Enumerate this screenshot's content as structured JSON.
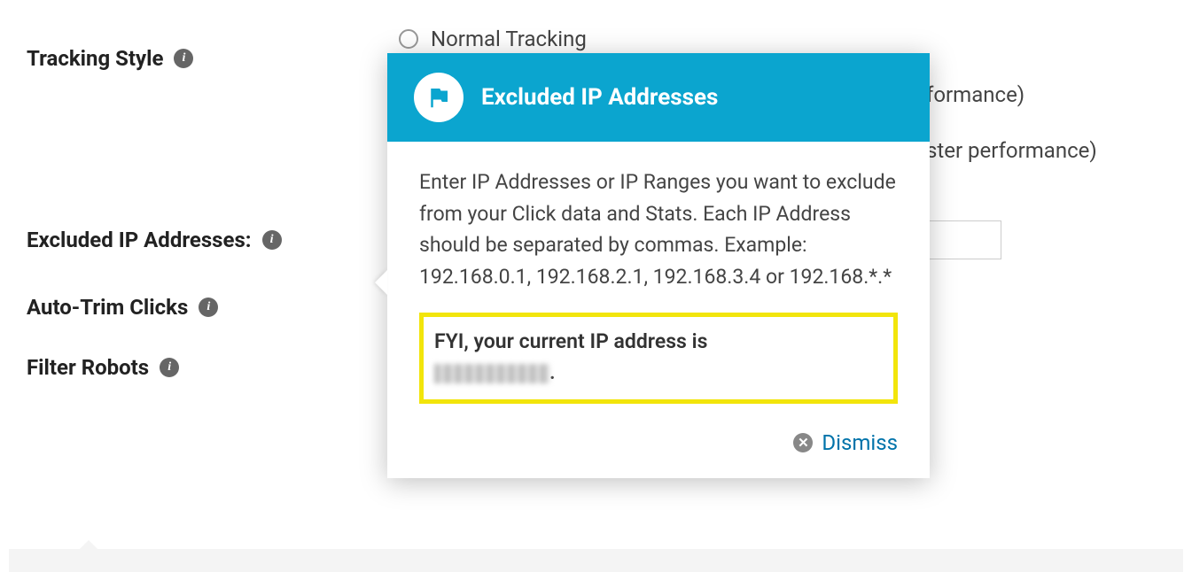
{
  "settings": {
    "tracking_style": {
      "label": "Tracking Style"
    },
    "excluded_ip": {
      "label": "Excluded IP Addresses:"
    },
    "auto_trim": {
      "label": "Auto-Trim Clicks"
    },
    "filter_robots": {
      "label": "Filter Robots"
    }
  },
  "options": {
    "normal": "Normal Tracking",
    "opt2_tail": "formance)",
    "opt3_tail": "ster performance)"
  },
  "tooltip": {
    "title": "Excluded IP Addresses",
    "body": "Enter IP Addresses or IP Ranges you want to exclude from your Click data and Stats. Each IP Address should be separated by commas. Example: 192.168.0.1, 192.168.2.1, 192.168.3.4 or 192.168.*.*",
    "fyi": "FYI, your current IP address is",
    "dismiss": "Dismiss"
  }
}
